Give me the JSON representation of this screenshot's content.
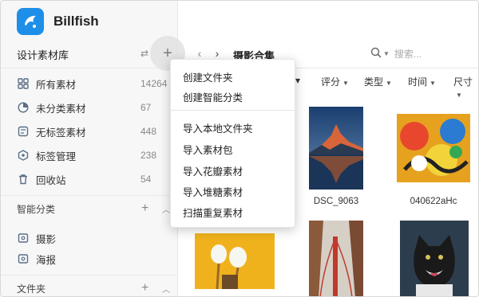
{
  "app": {
    "name": "Billfish"
  },
  "sidebar": {
    "library_name": "设计素材库",
    "items": [
      {
        "label": "所有素材",
        "count": "14264",
        "icon": "grid-icon"
      },
      {
        "label": "未分类素材",
        "count": "67",
        "icon": "pie-icon"
      },
      {
        "label": "无标签素材",
        "count": "448",
        "icon": "tag-icon"
      },
      {
        "label": "标签管理",
        "count": "238",
        "icon": "tag-manage-icon"
      },
      {
        "label": "回收站",
        "count": "54",
        "icon": "trash-icon"
      }
    ],
    "smart_section": {
      "label": "智能分类"
    },
    "smart_items": [
      {
        "label": "摄影",
        "icon": "smart-folder-icon"
      },
      {
        "label": "海报",
        "icon": "smart-folder-icon"
      }
    ],
    "folder_section": {
      "label": "文件夹"
    }
  },
  "main": {
    "title": "摄影合集",
    "search_placeholder": "搜索...",
    "filters": [
      "评分",
      "类型",
      "时间",
      "尺寸"
    ],
    "captions": [
      "DSC_9063",
      "040622aHc"
    ]
  },
  "menu": {
    "group1": [
      "创建文件夹",
      "创建智能分类"
    ],
    "group2": [
      "导入本地文件夹",
      "导入素材包",
      "导入花瓣素材",
      "导入堆糖素材",
      "扫描重复素材"
    ]
  },
  "colors": {
    "accent": "#1e8fe8",
    "sidebar_bg": "#f7f7f8"
  }
}
